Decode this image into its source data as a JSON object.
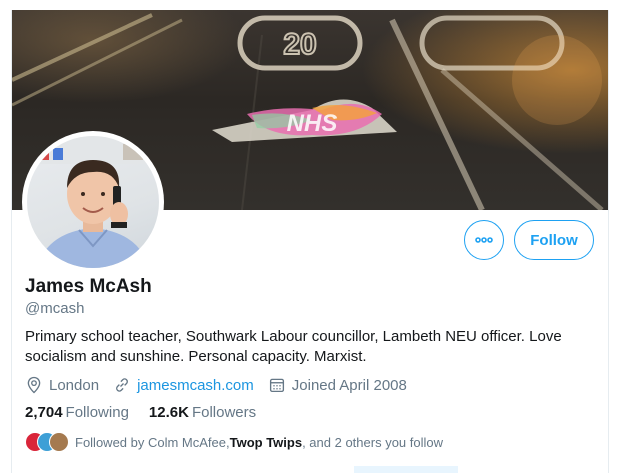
{
  "profile": {
    "name": "James McAsh",
    "handle": "@mcash",
    "bio": "Primary school teacher, Southwark Labour councillor, Lambeth NEU officer. Love socialism and sunshine. Personal capacity. Marxist.",
    "location": "London",
    "website": "jamesmcash.com",
    "joined": "Joined April 2008"
  },
  "stats": {
    "following_count": "2,704",
    "following_label": "Following",
    "followers_count": "12.6K",
    "followers_label": "Followers"
  },
  "followed_by": {
    "prefix": "Followed by Colm McAfee, ",
    "name2": "Twop Twips",
    "suffix": ", and 2 others you follow"
  },
  "actions": {
    "follow_label": "Follow",
    "more_icon": "more-horizontal-icon"
  },
  "banner": {
    "road_marking": "20",
    "heart_text": "NHS"
  },
  "colors": {
    "accent": "#1da1f2",
    "link": "#1b95e0",
    "secondary_text": "#657786"
  }
}
